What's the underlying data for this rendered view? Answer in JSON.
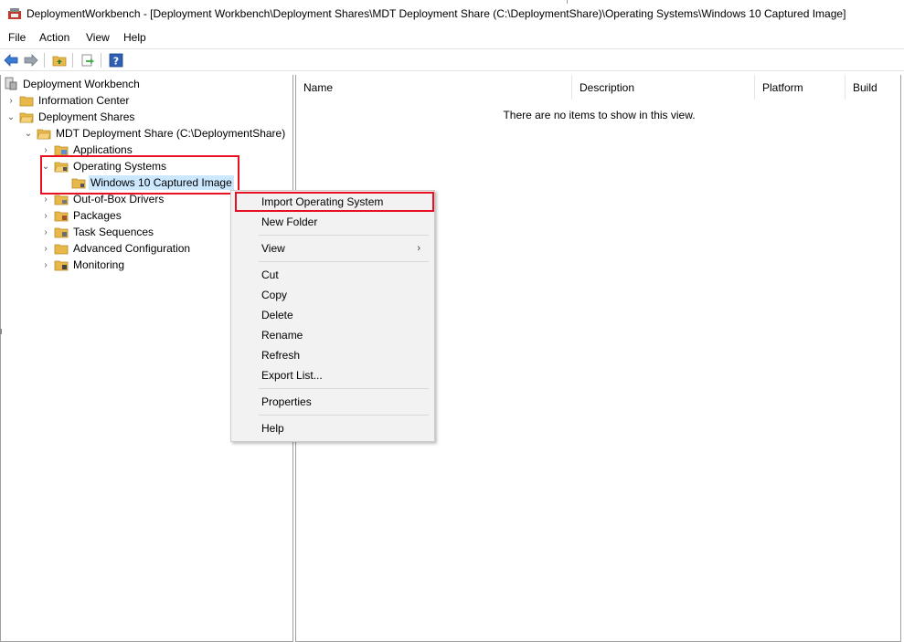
{
  "window": {
    "title": "DeploymentWorkbench - [Deployment Workbench\\Deployment Shares\\MDT Deployment Share (C:\\DeploymentShare)\\Operating Systems\\Windows 10 Captured Image]"
  },
  "menubar": {
    "file": "File",
    "action": "Action",
    "view": "View",
    "help": "Help"
  },
  "toolbar": {
    "icons": [
      "back-arrow-icon",
      "forward-arrow-icon",
      "up-folder-icon",
      "export-list-icon",
      "help-icon"
    ]
  },
  "tree": {
    "root": "Deployment Workbench",
    "information_center": "Information Center",
    "deployment_shares": "Deployment Shares",
    "mdt_share": "MDT Deployment Share (C:\\DeploymentShare)",
    "applications": "Applications",
    "operating_systems": "Operating Systems",
    "win10_captured": "Windows 10 Captured Image",
    "drivers": "Out-of-Box Drivers",
    "packages": "Packages",
    "task_sequences": "Task Sequences",
    "advanced_config": "Advanced Configuration",
    "monitoring": "Monitoring"
  },
  "list": {
    "columns": [
      "Name",
      "Description",
      "Platform",
      "Build"
    ],
    "empty_message": "There are no items to show in this view."
  },
  "context_menu": {
    "import_os": "Import Operating System",
    "new_folder": "New Folder",
    "view": "View",
    "cut": "Cut",
    "copy": "Copy",
    "delete": "Delete",
    "rename": "Rename",
    "refresh": "Refresh",
    "export_list": "Export List...",
    "properties": "Properties",
    "help": "Help"
  },
  "colors": {
    "highlight": "#e81123",
    "selection": "#cce8ff",
    "folder": "#e8b84a"
  }
}
